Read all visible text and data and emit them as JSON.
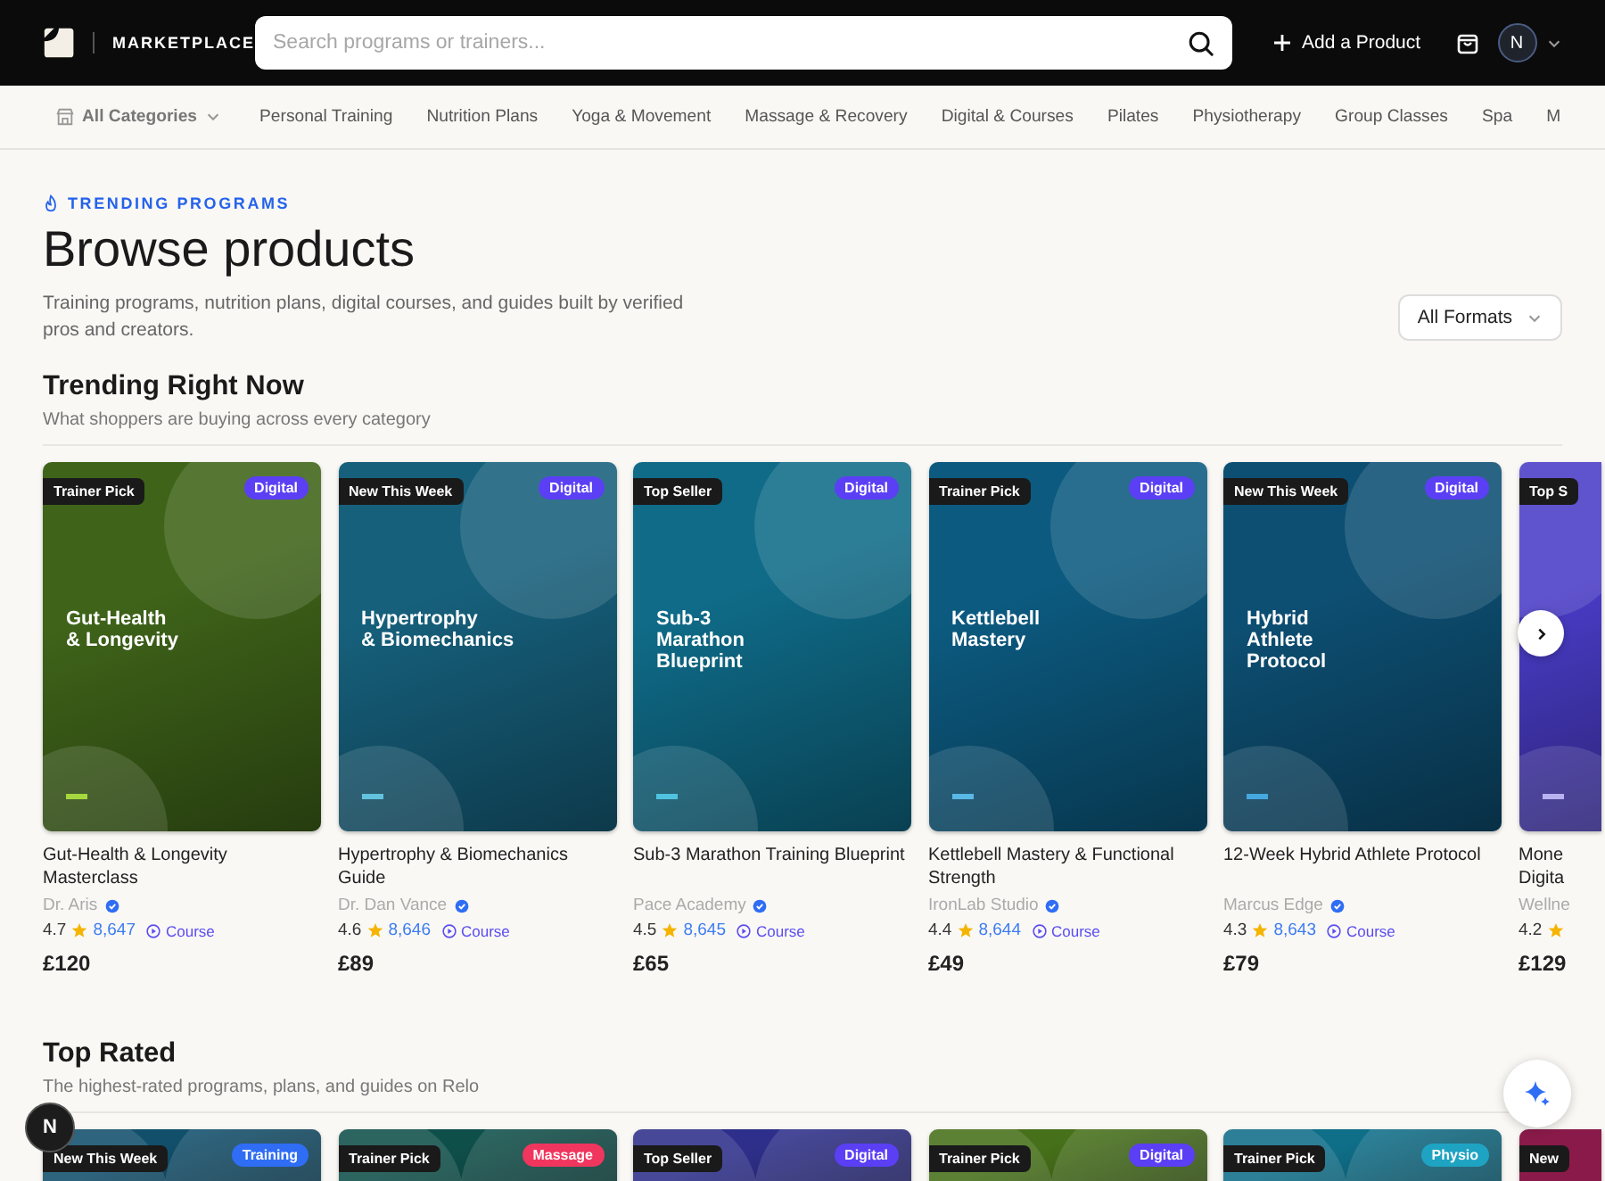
{
  "header": {
    "logo_text": "MARKETPLACE",
    "search": {
      "placeholder": "Search programs or trainers..."
    },
    "add_button": "Add a Product",
    "avatar": "N"
  },
  "categories": {
    "all_label": "All Categories",
    "items": [
      "Personal Training",
      "Nutrition Plans",
      "Yoga & Movement",
      "Massage & Recovery",
      "Digital & Courses",
      "Pilates",
      "Physiotherapy",
      "Group Classes",
      "Spa",
      "M"
    ]
  },
  "hero": {
    "eyebrow": "TRENDING PROGRAMS",
    "title": "Browse products",
    "description": "Training programs, nutrition plans, digital courses, and guides built by verified pros and creators.",
    "format_select": "All Formats"
  },
  "sections": [
    {
      "title": "Trending Right Now",
      "subtitle": "What shoppers are buying across every category",
      "products": [
        {
          "kind": "full",
          "badge": "Trainer Pick",
          "format": {
            "label": "Digital",
            "color": "#5b3ff5"
          },
          "cover": {
            "title": "Gut-Health\n& Longevity",
            "color": "#3f6419",
            "accent": {
              "color": "#a6d83e"
            }
          },
          "title": "Gut-Health & Longevity Masterclass",
          "creator": "Dr. Aris",
          "rating": "4.7",
          "reviews": "8,647",
          "type": "Course",
          "price": "£120"
        },
        {
          "kind": "full",
          "badge": "New This Week",
          "format": {
            "label": "Digital",
            "color": "#5b3ff5"
          },
          "cover": {
            "title": "Hypertrophy\n& Biomechanics",
            "color": "#16607c",
            "accent": {
              "color": "#63c3de"
            }
          },
          "title": "Hypertrophy & Biomechanics Guide",
          "creator": "Dr. Dan Vance",
          "rating": "4.6",
          "reviews": "8,646",
          "type": "Course",
          "price": "£89"
        },
        {
          "kind": "full",
          "badge": "Top Seller",
          "format": {
            "label": "Digital",
            "color": "#5b3ff5"
          },
          "cover": {
            "title": "Sub-3\nMarathon\nBlueprint",
            "color": "#0f6b88",
            "accent": {
              "color": "#4fc3e0"
            }
          },
          "title": "Sub-3 Marathon Training Blueprint",
          "creator": "Pace Academy",
          "rating": "4.5",
          "reviews": "8,645",
          "type": "Course",
          "price": "£65"
        },
        {
          "kind": "full",
          "badge": "Trainer Pick",
          "format": {
            "label": "Digital",
            "color": "#5b3ff5"
          },
          "cover": {
            "title": "Kettlebell\nMastery",
            "color": "#0c5a80",
            "accent": {
              "color": "#5ab8e6"
            }
          },
          "title": "Kettlebell Mastery & Functional Strength",
          "creator": "IronLab Studio",
          "rating": "4.4",
          "reviews": "8,644",
          "type": "Course",
          "price": "£49"
        },
        {
          "kind": "full",
          "badge": "New This Week",
          "format": {
            "label": "Digital",
            "color": "#5b3ff5"
          },
          "cover": {
            "title": "Hybrid\nAthlete\nProtocol",
            "color": "#0d4f73",
            "accent": {
              "color": "#45a8e0"
            }
          },
          "title": "12-Week Hybrid Athlete Protocol",
          "creator": "Marcus Edge",
          "rating": "4.3",
          "reviews": "8,643",
          "type": "Course",
          "price": "£79"
        },
        {
          "kind": "partial",
          "badge": "Top S",
          "cover": {
            "color": "#4a3cc8",
            "accent": {
              "color": "#b9b2f0"
            }
          },
          "title": "Mone Digita",
          "creator": "Wellne",
          "rating": "4.2",
          "price": "£129"
        }
      ]
    },
    {
      "title": "Top Rated",
      "subtitle": "The highest-rated programs, plans, and guides on Relo",
      "products": [
        {
          "kind": "full",
          "badge": "New This Week",
          "format": {
            "label": "Training",
            "color": "#2f6df5"
          },
          "cover": {
            "color": "#124f6b"
          }
        },
        {
          "kind": "full",
          "badge": "Trainer Pick",
          "format": {
            "label": "Massage",
            "color": "#f0365e"
          },
          "cover": {
            "color": "#0f4f4a"
          }
        },
        {
          "kind": "full",
          "badge": "Top Seller",
          "format": {
            "label": "Digital",
            "color": "#5b3ff5"
          },
          "cover": {
            "color": "#2e2f8a"
          }
        },
        {
          "kind": "full",
          "badge": "Trainer Pick",
          "format": {
            "label": "Digital",
            "color": "#5b3ff5"
          },
          "cover": {
            "color": "#46701a"
          }
        },
        {
          "kind": "full",
          "badge": "Trainer Pick",
          "format": {
            "label": "Physio",
            "color": "#1fa3c2"
          },
          "cover": {
            "color": "#0f6e88"
          }
        },
        {
          "kind": "partial",
          "badge": "New",
          "cover": {
            "color": "#8a1a4a"
          }
        }
      ]
    }
  ],
  "floating": {
    "badge": "N"
  }
}
